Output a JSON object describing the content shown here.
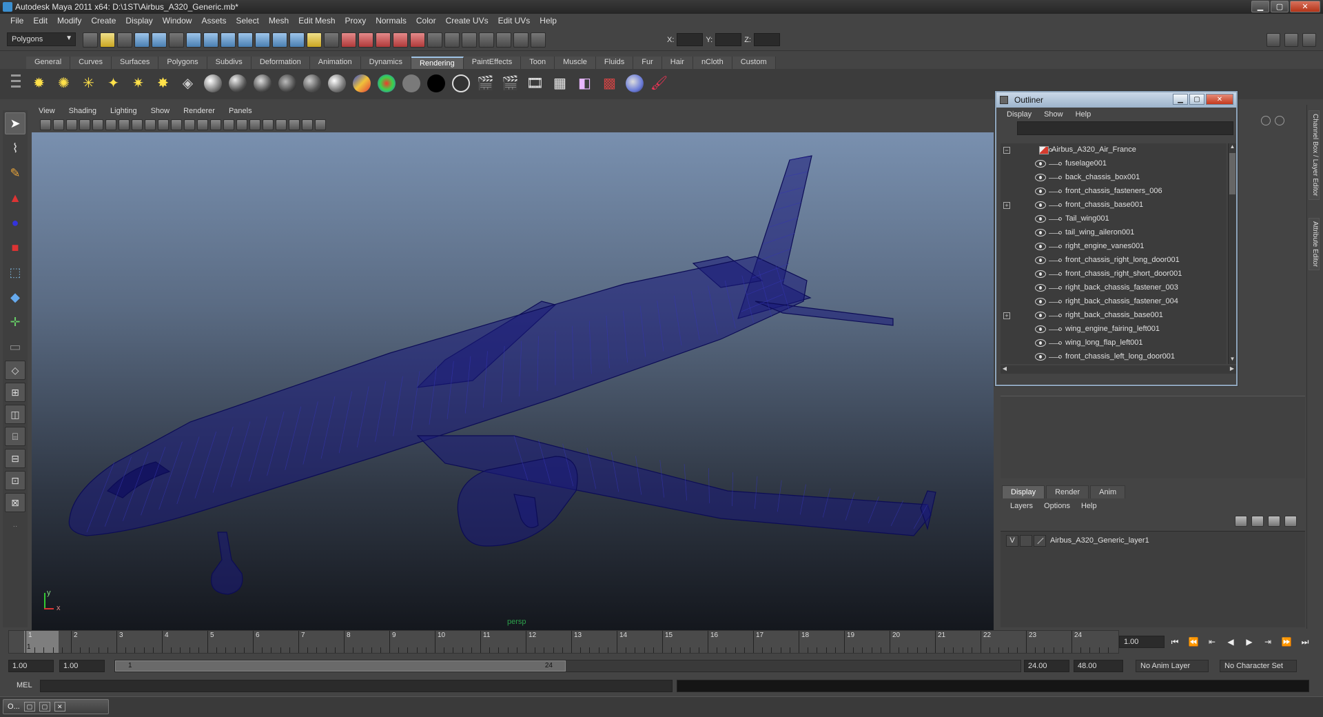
{
  "window": {
    "title": "Autodesk Maya 2011 x64: D:\\1ST\\Airbus_A320_Generic.mb*",
    "min": "▁",
    "max": "▢",
    "close": "✕"
  },
  "menubar": [
    "File",
    "Edit",
    "Modify",
    "Create",
    "Display",
    "Window",
    "Assets",
    "Select",
    "Mesh",
    "Edit Mesh",
    "Proxy",
    "Normals",
    "Color",
    "Create UVs",
    "Edit UVs",
    "Help"
  ],
  "statusline": {
    "mode": "Polygons",
    "x_label": "X:",
    "y_label": "Y:",
    "z_label": "Z:"
  },
  "shelf": {
    "tabs": [
      "General",
      "Curves",
      "Surfaces",
      "Polygons",
      "Subdivs",
      "Deformation",
      "Animation",
      "Dynamics",
      "Rendering",
      "PaintEffects",
      "Toon",
      "Muscle",
      "Fluids",
      "Fur",
      "Hair",
      "nCloth",
      "Custom"
    ],
    "active_tab": "Rendering"
  },
  "viewport": {
    "menus": [
      "View",
      "Shading",
      "Lighting",
      "Show",
      "Renderer",
      "Panels"
    ],
    "camera_label": "persp",
    "axis_y": "y",
    "axis_x": "x",
    "wire_color": "#1a1a7a"
  },
  "outliner": {
    "title": "Outliner",
    "menus": [
      "Display",
      "Show",
      "Help"
    ],
    "root": "Airbus_A320_Air_France",
    "items": [
      {
        "name": "fuselage001",
        "expandable": false
      },
      {
        "name": "back_chassis_box001",
        "expandable": false
      },
      {
        "name": "front_chassis_fasteners_006",
        "expandable": false
      },
      {
        "name": "front_chassis_base001",
        "expandable": true
      },
      {
        "name": "Tail_wing001",
        "expandable": false
      },
      {
        "name": "tail_wing_aileron001",
        "expandable": false
      },
      {
        "name": "right_engine_vanes001",
        "expandable": false
      },
      {
        "name": "front_chassis_right_long_door001",
        "expandable": false
      },
      {
        "name": "front_chassis_right_short_door001",
        "expandable": false
      },
      {
        "name": "right_back_chassis_fastener_003",
        "expandable": false
      },
      {
        "name": "right_back_chassis_fastener_004",
        "expandable": false
      },
      {
        "name": "right_back_chassis_base001",
        "expandable": true
      },
      {
        "name": "wing_engine_fairing_left001",
        "expandable": false
      },
      {
        "name": "wing_long_flap_left001",
        "expandable": false
      },
      {
        "name": "front_chassis_left_long_door001",
        "expandable": false
      }
    ]
  },
  "side_tabs": [
    "Channel Box / Layer Editor",
    "Attribute Editor"
  ],
  "layer_editor": {
    "tabs": [
      "Display",
      "Render",
      "Anim"
    ],
    "active_tab": "Display",
    "menus": [
      "Layers",
      "Options",
      "Help"
    ],
    "layers": [
      {
        "visible": "V",
        "name": "Airbus_A320_Generic_layer1"
      }
    ]
  },
  "timeline": {
    "current_frame": "1.00",
    "playhead_label": "1",
    "ticks": [
      "1",
      "2",
      "3",
      "4",
      "5",
      "6",
      "7",
      "8",
      "9",
      "10",
      "11",
      "12",
      "13",
      "14",
      "15",
      "16",
      "17",
      "18",
      "19",
      "20",
      "21",
      "22",
      "23",
      "24"
    ],
    "playback": [
      "⏮",
      "⏪",
      "⇤",
      "◀",
      "▶",
      "⇥",
      "⏩",
      "⏭"
    ]
  },
  "range": {
    "start": "1.00",
    "playback_start": "1.00",
    "range_start_label": "1",
    "range_end_label": "24",
    "playback_end": "24.00",
    "end": "48.00",
    "anim_layer": "No Anim Layer",
    "character_set": "No Character Set"
  },
  "cmdline": {
    "label": "MEL"
  },
  "taskbar": {
    "item": "O..."
  }
}
